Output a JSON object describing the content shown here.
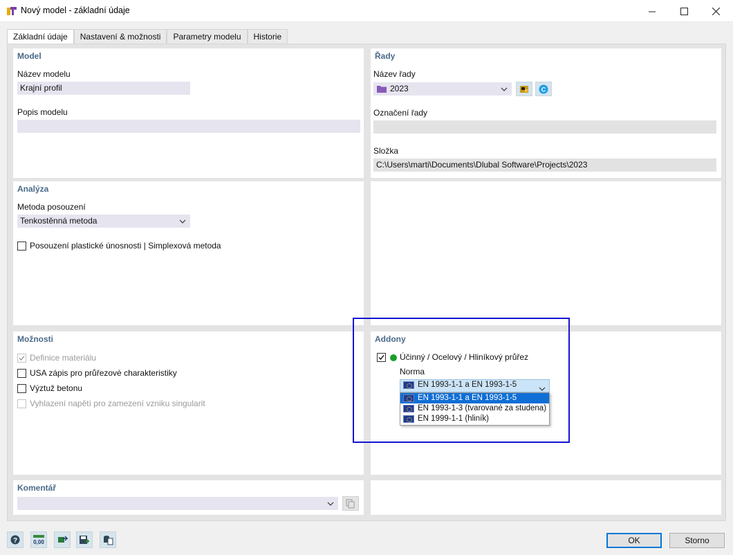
{
  "window": {
    "title": "Nový model - základní údaje",
    "minimize_icon": "minimize-icon",
    "maximize_icon": "maximize-icon",
    "close_icon": "close-icon"
  },
  "tabs": [
    {
      "label": "Základní údaje",
      "active": true
    },
    {
      "label": "Nastavení & možnosti",
      "active": false
    },
    {
      "label": "Parametry modelu",
      "active": false
    },
    {
      "label": "Historie",
      "active": false
    }
  ],
  "model": {
    "title": "Model",
    "name_label": "Název modelu",
    "name_value": "Krajní profil",
    "desc_label": "Popis modelu",
    "desc_value": ""
  },
  "series": {
    "title": "Řady",
    "name_label": "Název řady",
    "name_value": "2023",
    "designation_label": "Označení řady",
    "designation_value": "",
    "folder_label": "Složka",
    "folder_value": "C:\\Users\\marti\\Documents\\Dlubal Software\\Projects\\2023"
  },
  "analysis": {
    "title": "Analýza",
    "method_label": "Metoda posouzení",
    "method_value": "Tenkostěnná metoda",
    "plastic_label": "Posouzení plastické únosnosti | Simplexová metoda",
    "plastic_checked": false
  },
  "options": {
    "title": "Možnosti",
    "items": [
      {
        "label": "Definice materiálu",
        "checked": true,
        "disabled": true
      },
      {
        "label": "USA zápis pro průřezové charakteristiky",
        "checked": false,
        "disabled": false
      },
      {
        "label": "Výztuž betonu",
        "checked": false,
        "disabled": false
      },
      {
        "label": "Vyhlazení napětí pro zamezení vzniku singularit",
        "checked": false,
        "disabled": true
      }
    ]
  },
  "addons": {
    "title": "Addony",
    "addon_label": "Účinný / Ocelový / Hliníkový průřez",
    "addon_checked": true,
    "status_color": "#1a9e2a",
    "norm_label": "Norma",
    "norm_selected": "EN 1993-1-1 a EN 1993-1-5",
    "norm_options": [
      "EN 1993-1-1 a EN 1993-1-5",
      "EN 1993-1-3 (tvarované za studena)",
      "EN 1999-1-1 (hliník)"
    ]
  },
  "comment": {
    "title": "Komentář",
    "value": ""
  },
  "buttons": {
    "ok": "OK",
    "cancel": "Storno"
  },
  "toolbar_icons": [
    "help-icon",
    "units-icon",
    "export-icon",
    "save-settings-icon",
    "library-icon"
  ],
  "highlight_color": "#1515d4",
  "accent_color": "#0f6fd6"
}
